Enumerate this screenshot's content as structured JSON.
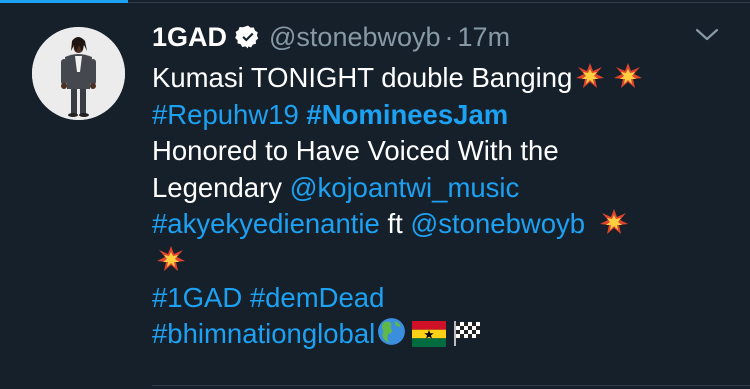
{
  "tweet": {
    "display_name": "1GAD",
    "handle": "@stonebwoyb",
    "separator": "·",
    "time": "17m",
    "lines": {
      "l1_text": "Kumasi TONIGHT double Banging",
      "l2_tag1": "#Repuhw19",
      "l2_tag2": "#NomineesJam",
      "l3_text": "Honored to Have Voiced With the",
      "l4_text": "Legendary ",
      "l4_mention": "@kojoantwi_music",
      "l5_tag": "#akyekyedienantie",
      "l5_text": " ft ",
      "l5_mention": "@stonebwoyb",
      "l7_tag1": "#1GAD",
      "l7_tag2": "#demDead",
      "l8_tag": "#bhimnationglobal"
    },
    "icons": {
      "verified": "verified-badge-icon",
      "menu": "chevron-down-icon",
      "collision": "collision-emoji",
      "globe": "globe-americas-emoji",
      "flag": "ghana-flag-emoji",
      "checkered": "checkered-flag-emoji"
    }
  },
  "colors": {
    "background": "#15202b",
    "link": "#1da1f2",
    "muted": "#8899a6",
    "text": "#ffffff"
  }
}
